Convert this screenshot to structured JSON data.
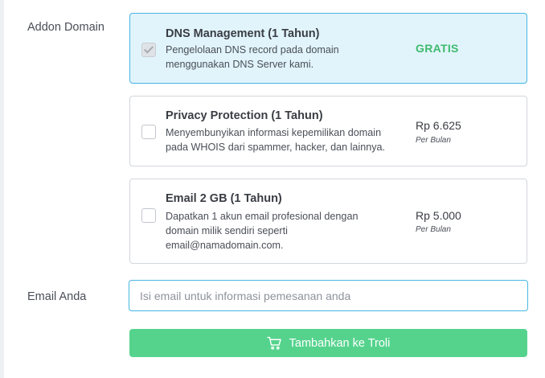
{
  "addon": {
    "label": "Addon Domain",
    "items": [
      {
        "title": "DNS Management (1 Tahun)",
        "desc_lines": [
          "Pengelolaan DNS record pada domain",
          "menggunakan DNS Server kami."
        ],
        "price": "GRATIS",
        "checked": true
      },
      {
        "title": "Privacy Protection (1 Tahun)",
        "desc_lines": [
          "Menyembunyikan informasi kepemilikan domain",
          "pada WHOIS dari spammer, hacker, dan lainnya."
        ],
        "price": "Rp 6.625",
        "price_unit": "Per Bulan",
        "checked": false
      },
      {
        "title": "Email 2 GB (1 Tahun)",
        "desc_lines": [
          "Dapatkan 1 akun email profesional dengan",
          "domain milik sendiri seperti",
          "email@namadomain.com."
        ],
        "price": "Rp 5.000",
        "price_unit": "Per Bulan",
        "checked": false
      }
    ]
  },
  "email": {
    "label": "Email Anda",
    "value": "",
    "placeholder": "Isi email untuk informasi pemesanan anda"
  },
  "cart_button": {
    "label": "Tambahkan ke Troli",
    "icon": "cart-icon"
  },
  "colors": {
    "selected_bg": "#e1f4fb",
    "selected_border": "#46b5e4",
    "free_text": "#3fba6f",
    "button_bg": "#55d38d"
  }
}
